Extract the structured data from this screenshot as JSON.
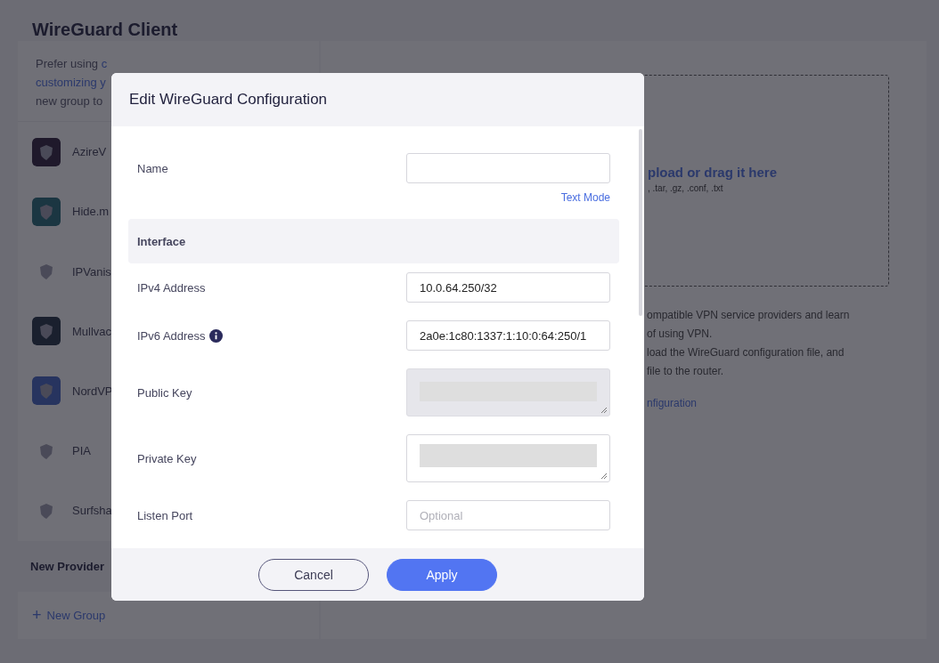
{
  "page": {
    "title": "WireGuard Client"
  },
  "sidebar": {
    "hint": [
      [
        {
          "text": "Prefer using ",
          "link": false
        },
        {
          "text": "c",
          "link": true
        }
      ],
      [
        {
          "text": "customizing y",
          "link": true
        }
      ],
      [
        {
          "text": "new group to",
          "link": false
        }
      ]
    ],
    "providers": [
      {
        "name": "AzireV",
        "color": "#1f192b"
      },
      {
        "name": "Hide.m",
        "color": "#1b3642"
      },
      {
        "name": "IPVanis"
      },
      {
        "name": "Mullvac",
        "color": "#1a202e"
      },
      {
        "name": "NordVP",
        "color": "#27345f"
      },
      {
        "name": "PIA"
      },
      {
        "name": "Surfsha"
      }
    ],
    "group_header": "New Provider",
    "new_group": {
      "icon": "+",
      "label": "New Group"
    }
  },
  "main": {
    "upload_title": "pload or drag it here",
    "upload_types": ", .tar, .gz, .conf, .txt",
    "description": [
      "ompatible VPN service providers and learn",
      "of using VPN.",
      "load the WireGuard configuration file, and",
      "file to the router."
    ],
    "link": "nfiguration"
  },
  "dialog": {
    "title": "Edit WireGuard Configuration",
    "name_field": {
      "label": "Name"
    },
    "text_mode": "Text Mode",
    "section": "Interface",
    "fields": [
      {
        "kind": "input",
        "label": "IPv4 Address",
        "value": "10.0.64.250/32",
        "info": false,
        "disabled": false
      },
      {
        "kind": "input",
        "label": "IPv6 Address",
        "value": "2a0e:1c80:1337:1:10:0:64:250/1",
        "info": true,
        "disabled": false
      },
      {
        "kind": "redacted",
        "label": "Public Key",
        "info": false,
        "disabled": true
      },
      {
        "kind": "redacted",
        "label": "Private Key",
        "info": false,
        "disabled": false
      },
      {
        "kind": "input",
        "label": "Listen Port",
        "placeholder": "Optional",
        "info": false,
        "disabled": false
      }
    ],
    "buttons": [
      {
        "kind": "secondary",
        "label": "Cancel"
      },
      {
        "kind": "primary",
        "label": "Apply"
      }
    ]
  }
}
